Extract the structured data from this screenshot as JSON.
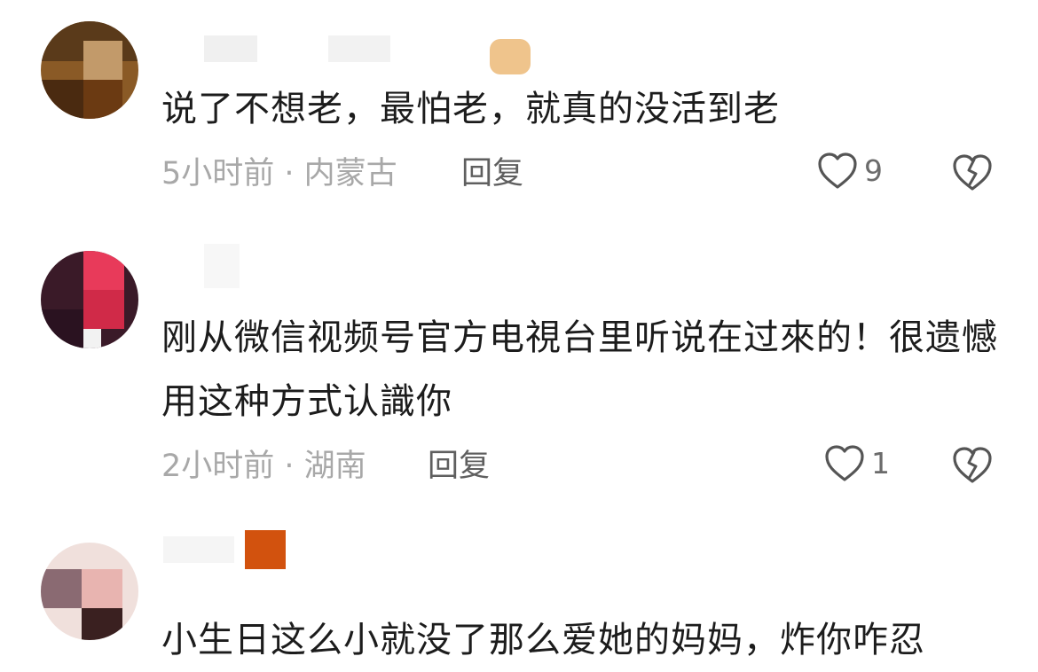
{
  "comments": [
    {
      "text": "说了不想老，最怕老，就真的没活到老",
      "time": "5小时前 · 内蒙古",
      "reply_label": "回复",
      "likes": "9"
    },
    {
      "text": "刚从微信视频号官方电視台里听说在过來的！很遗憾用这种方式认識你",
      "time": "2小时前 · 湖南",
      "reply_label": "回复",
      "likes": "1"
    },
    {
      "text": "小生日这么小就没了那么爱她的妈妈，炸你咋忍"
    }
  ],
  "icons": {
    "like": "heart-outline-icon",
    "dislike": "broken-heart-icon"
  },
  "colors": {
    "text": "#1c1c1c",
    "meta": "#a8a8a8",
    "reply": "#5f5f5f",
    "icon": "#555555"
  }
}
